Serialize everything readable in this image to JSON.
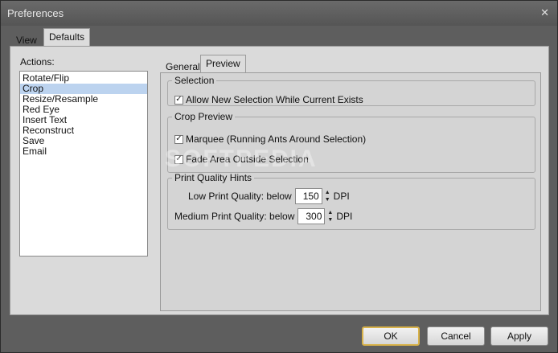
{
  "window": {
    "title": "Preferences",
    "close_glyph": "✕"
  },
  "outer_tabs": [
    {
      "label": "View",
      "active": false
    },
    {
      "label": "Defaults",
      "active": true
    }
  ],
  "actions": {
    "label": "Actions:",
    "items": [
      "Rotate/Flip",
      "Crop",
      "Resize/Resample",
      "Red Eye",
      "Insert Text",
      "Reconstruct",
      "Save",
      "Email"
    ],
    "selected": "Crop"
  },
  "inner_tabs": [
    {
      "label": "General",
      "active": false
    },
    {
      "label": "Preview",
      "active": true
    }
  ],
  "selection_group": {
    "title": "Selection",
    "allow_new_selection": {
      "label": "Allow New Selection While Current Exists",
      "checked": true
    }
  },
  "crop_preview_group": {
    "title": "Crop Preview",
    "marquee": {
      "label": "Marquee (Running Ants Around Selection)",
      "checked": true
    },
    "fade_area": {
      "label": "Fade Area Outside Selection",
      "checked": true
    }
  },
  "print_quality_group": {
    "title": "Print Quality Hints",
    "low": {
      "label": "Low Print Quality: below",
      "value": "150",
      "unit": "DPI"
    },
    "medium": {
      "label": "Medium Print Quality: below",
      "value": "300",
      "unit": "DPI"
    }
  },
  "watermark": "SOFTPEDIA",
  "buttons": {
    "ok": "OK",
    "cancel": "Cancel",
    "apply": "Apply"
  },
  "icons": {
    "checkmark": "✓",
    "spin_up": "▲",
    "spin_down": "▼"
  },
  "colors": {
    "selected_item": "#bcd3ef",
    "default_button_border": "#d8b24a"
  }
}
